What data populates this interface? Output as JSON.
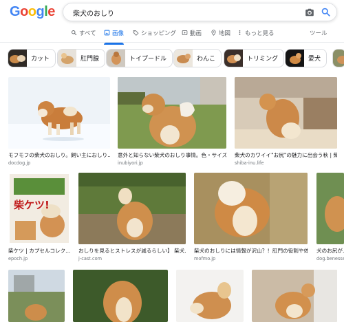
{
  "logo": {
    "letters": [
      "G",
      "o",
      "o",
      "g",
      "l",
      "e"
    ],
    "colors": [
      "#4285F4",
      "#EA4335",
      "#FBBC05",
      "#4285F4",
      "#34A853",
      "#EA4335"
    ]
  },
  "search": {
    "query": "柴犬のおしり"
  },
  "tabs": [
    {
      "label": "すべて",
      "icon": "search-icon",
      "active": false
    },
    {
      "label": "画像",
      "icon": "image-icon",
      "active": true
    },
    {
      "label": "ショッピング",
      "icon": "tag-icon",
      "active": false
    },
    {
      "label": "動画",
      "icon": "play-icon",
      "active": false
    },
    {
      "label": "地図",
      "icon": "map-icon",
      "active": false
    },
    {
      "label": "もっと見る",
      "icon": "more-vert-icon",
      "active": false
    },
    {
      "label": "ツール",
      "icon": "",
      "active": false
    }
  ],
  "chips": [
    "カット",
    "肛門腺",
    "トイプードル",
    "わんこ",
    "トリミング",
    "愛犬"
  ],
  "results": [
    {
      "caption": "モフモフの柴犬のおしり。飼い主におしり...",
      "source": "docdog.jp"
    },
    {
      "caption": "意外と知らない柴犬のおしり事情。色・サイズ...",
      "source": "inubiyori.jp"
    },
    {
      "caption": "柴犬のカワイイ\"お尻\"の魅力に出会う秋 | 柴...",
      "source": "shiba-inu.life"
    },
    {
      "caption": "柴ケツ | カプセルコレク...",
      "source": "epoch.jp"
    },
    {
      "caption": "おしりを見るとストレスが減るらしい】 柴犬...",
      "source": "j-cast.com"
    },
    {
      "caption": "柴犬のおしりには情報が沢山？！肛門の役割や体...",
      "source": "mofmo.jp"
    },
    {
      "caption": "犬のお尻が...",
      "source": "dog.benesse..."
    }
  ],
  "product_label": "柴ケツ!",
  "colors": {
    "accent": "#1a73e8",
    "muted": "#70757a"
  }
}
